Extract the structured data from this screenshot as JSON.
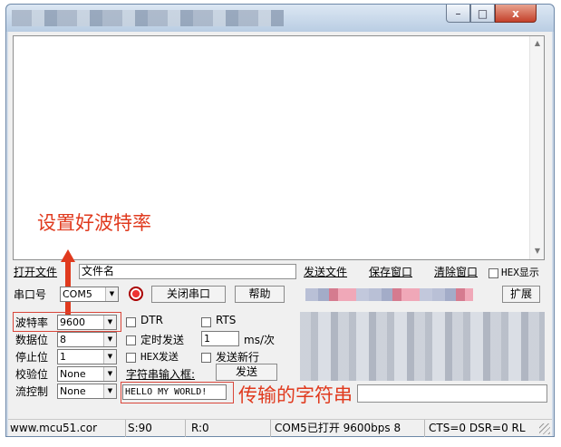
{
  "titlebar": {
    "minimize": "–",
    "maximize": "□",
    "close": "x"
  },
  "toolbar": {
    "open_file": "打开文件",
    "file_name": "文件名",
    "send_file": "发送文件",
    "save_window": "保存窗口",
    "clear_window": "清除窗口",
    "hex_display": "HEX显示"
  },
  "port": {
    "port_label": "串口号",
    "port_value": "COM5",
    "close_port": "关闭串口",
    "help": "帮助",
    "expand": "扩展"
  },
  "settings": {
    "baud_label": "波特率",
    "baud_value": "9600",
    "databits_label": "数据位",
    "databits_value": "8",
    "stopbits_label": "停止位",
    "stopbits_value": "1",
    "parity_label": "校验位",
    "parity_value": "None",
    "flow_label": "流控制",
    "flow_value": "None"
  },
  "options": {
    "dtr": "DTR",
    "rts": "RTS",
    "timed_send": "定时发送",
    "interval_value": "1",
    "interval_unit": "ms/次",
    "hex_send": "HEX发送",
    "send_newline": "发送新行",
    "string_input_label": "字符串输入框:",
    "send_button": "发送",
    "send_text": "HELLO MY WORLD!"
  },
  "annotations": {
    "set_baud": "设置好波特率",
    "transmit_string": "传输的字符串"
  },
  "statusbar": {
    "url": "www.mcu51.cor",
    "sent": "S:90",
    "received": "R:0",
    "port_status": "COM5已打开  9600bps  8",
    "line_status": "CTS=0 DSR=0 RL"
  },
  "colors": {
    "annotation": "#e03a1e",
    "title_bg": "#b9cde3",
    "close_button": "#c4412b"
  }
}
